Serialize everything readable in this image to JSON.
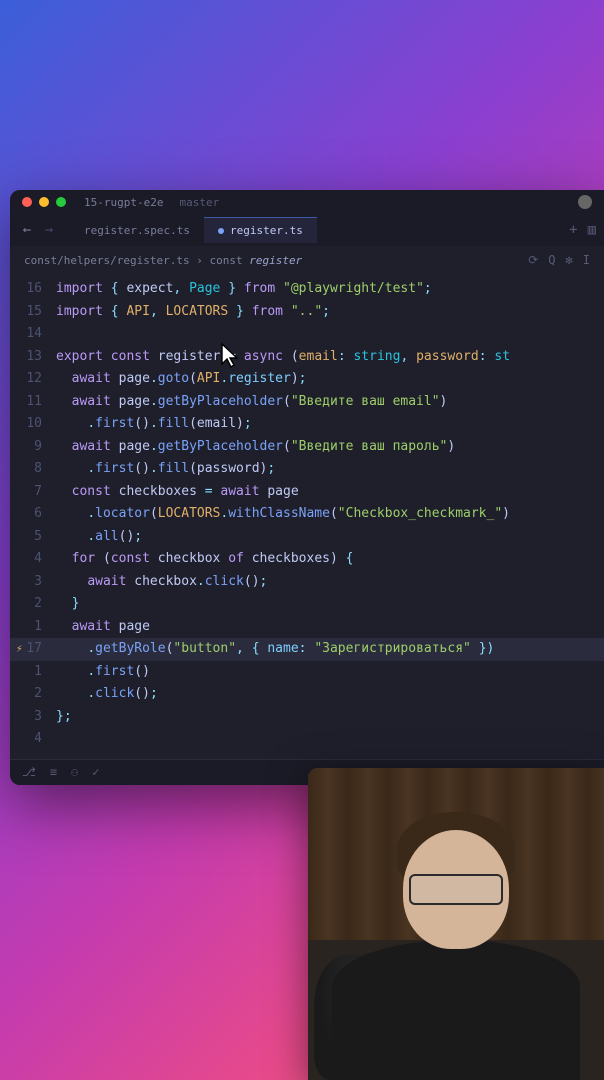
{
  "window": {
    "project": "15-rugpt-e2e",
    "branch": "master"
  },
  "tabs": [
    {
      "label": "register.spec.ts",
      "active": false
    },
    {
      "label": "register.ts",
      "active": true
    }
  ],
  "breadcrumb": {
    "path": "const/helpers/register.ts",
    "sep": " › ",
    "symbol_kw": "const",
    "symbol_name": "register"
  },
  "code": {
    "lines": [
      {
        "n": "16",
        "tokens": [
          [
            "tok-kw",
            "import"
          ],
          [
            "",
            " "
          ],
          [
            "tok-punc",
            "{"
          ],
          [
            "",
            " "
          ],
          [
            "tok-var",
            "expect"
          ],
          [
            "tok-punc",
            ","
          ],
          [
            "",
            " "
          ],
          [
            "tok-type",
            "Page"
          ],
          [
            "",
            " "
          ],
          [
            "tok-punc",
            "}"
          ],
          [
            "",
            " "
          ],
          [
            "tok-kw",
            "from"
          ],
          [
            "",
            " "
          ],
          [
            "tok-str",
            "\"@playwright/test\""
          ],
          [
            "tok-punc",
            ";"
          ]
        ]
      },
      {
        "n": "15",
        "tokens": [
          [
            "tok-kw",
            "import"
          ],
          [
            "",
            " "
          ],
          [
            "tok-punc",
            "{"
          ],
          [
            "",
            " "
          ],
          [
            "tok-const",
            "API"
          ],
          [
            "tok-punc",
            ","
          ],
          [
            "",
            " "
          ],
          [
            "tok-const",
            "LOCATORS"
          ],
          [
            "",
            " "
          ],
          [
            "tok-punc",
            "}"
          ],
          [
            "",
            " "
          ],
          [
            "tok-kw",
            "from"
          ],
          [
            "",
            " "
          ],
          [
            "tok-str",
            "\"..\""
          ],
          [
            "tok-punc",
            ";"
          ]
        ]
      },
      {
        "n": "14",
        "tokens": []
      },
      {
        "n": "13",
        "tokens": [
          [
            "tok-kw",
            "export"
          ],
          [
            "",
            " "
          ],
          [
            "tok-kw",
            "const"
          ],
          [
            "",
            " "
          ],
          [
            "tok-var",
            "register"
          ],
          [
            "",
            " "
          ],
          [
            "tok-punc",
            "="
          ],
          [
            "",
            " "
          ],
          [
            "tok-kw",
            "async"
          ],
          [
            "",
            " "
          ],
          [
            "tok-paren",
            "("
          ],
          [
            "tok-param",
            "email"
          ],
          [
            "tok-punc",
            ":"
          ],
          [
            "",
            " "
          ],
          [
            "tok-type",
            "string"
          ],
          [
            "tok-punc",
            ","
          ],
          [
            "",
            " "
          ],
          [
            "tok-param",
            "password"
          ],
          [
            "tok-punc",
            ":"
          ],
          [
            "",
            " "
          ],
          [
            "tok-type",
            "st"
          ]
        ]
      },
      {
        "n": "12",
        "tokens": [
          [
            "",
            "  "
          ],
          [
            "tok-kw",
            "await"
          ],
          [
            "",
            " "
          ],
          [
            "tok-var",
            "page"
          ],
          [
            "tok-dot",
            "."
          ],
          [
            "tok-fn",
            "goto"
          ],
          [
            "tok-paren",
            "("
          ],
          [
            "tok-const",
            "API"
          ],
          [
            "tok-dot",
            "."
          ],
          [
            "tok-prop",
            "register"
          ],
          [
            "tok-paren",
            ")"
          ],
          [
            "tok-punc",
            ";"
          ]
        ]
      },
      {
        "n": "11",
        "tokens": [
          [
            "",
            "  "
          ],
          [
            "tok-kw",
            "await"
          ],
          [
            "",
            " "
          ],
          [
            "tok-var",
            "page"
          ],
          [
            "tok-dot",
            "."
          ],
          [
            "tok-fn",
            "getByPlaceholder"
          ],
          [
            "tok-paren",
            "("
          ],
          [
            "tok-str",
            "\"Введите ваш email\""
          ],
          [
            "tok-paren",
            ")"
          ]
        ]
      },
      {
        "n": "10",
        "tokens": [
          [
            "",
            "    "
          ],
          [
            "tok-dot",
            "."
          ],
          [
            "tok-fn",
            "first"
          ],
          [
            "tok-paren",
            "()"
          ],
          [
            "tok-dot",
            "."
          ],
          [
            "tok-fn",
            "fill"
          ],
          [
            "tok-paren",
            "("
          ],
          [
            "tok-var",
            "email"
          ],
          [
            "tok-paren",
            ")"
          ],
          [
            "tok-punc",
            ";"
          ]
        ]
      },
      {
        "n": "9",
        "tokens": [
          [
            "",
            "  "
          ],
          [
            "tok-kw",
            "await"
          ],
          [
            "",
            " "
          ],
          [
            "tok-var",
            "page"
          ],
          [
            "tok-dot",
            "."
          ],
          [
            "tok-fn",
            "getByPlaceholder"
          ],
          [
            "tok-paren",
            "("
          ],
          [
            "tok-str",
            "\"Введите ваш пароль\""
          ],
          [
            "tok-paren",
            ")"
          ]
        ]
      },
      {
        "n": "8",
        "tokens": [
          [
            "",
            "    "
          ],
          [
            "tok-dot",
            "."
          ],
          [
            "tok-fn",
            "first"
          ],
          [
            "tok-paren",
            "()"
          ],
          [
            "tok-dot",
            "."
          ],
          [
            "tok-fn",
            "fill"
          ],
          [
            "tok-paren",
            "("
          ],
          [
            "tok-var",
            "password"
          ],
          [
            "tok-paren",
            ")"
          ],
          [
            "tok-punc",
            ";"
          ]
        ]
      },
      {
        "n": "7",
        "tokens": [
          [
            "",
            "  "
          ],
          [
            "tok-kw",
            "const"
          ],
          [
            "",
            " "
          ],
          [
            "tok-var",
            "checkboxes"
          ],
          [
            "",
            " "
          ],
          [
            "tok-punc",
            "="
          ],
          [
            "",
            " "
          ],
          [
            "tok-kw",
            "await"
          ],
          [
            "",
            " "
          ],
          [
            "tok-var",
            "page"
          ]
        ]
      },
      {
        "n": "6",
        "tokens": [
          [
            "",
            "    "
          ],
          [
            "tok-dot",
            "."
          ],
          [
            "tok-fn",
            "locator"
          ],
          [
            "tok-paren",
            "("
          ],
          [
            "tok-const",
            "LOCATORS"
          ],
          [
            "tok-dot",
            "."
          ],
          [
            "tok-fn",
            "withClassName"
          ],
          [
            "tok-paren",
            "("
          ],
          [
            "tok-str",
            "\"Checkbox_checkmark_\""
          ],
          [
            "tok-paren",
            ")"
          ]
        ]
      },
      {
        "n": "5",
        "tokens": [
          [
            "",
            "    "
          ],
          [
            "tok-dot",
            "."
          ],
          [
            "tok-fn",
            "all"
          ],
          [
            "tok-paren",
            "()"
          ],
          [
            "tok-punc",
            ";"
          ]
        ]
      },
      {
        "n": "4",
        "tokens": [
          [
            "",
            "  "
          ],
          [
            "tok-kw",
            "for"
          ],
          [
            "",
            " "
          ],
          [
            "tok-paren",
            "("
          ],
          [
            "tok-kw",
            "const"
          ],
          [
            "",
            " "
          ],
          [
            "tok-var",
            "checkbox"
          ],
          [
            "",
            " "
          ],
          [
            "tok-kw",
            "of"
          ],
          [
            "",
            " "
          ],
          [
            "tok-var",
            "checkboxes"
          ],
          [
            "tok-paren",
            ")"
          ],
          [
            "",
            " "
          ],
          [
            "tok-punc",
            "{"
          ]
        ]
      },
      {
        "n": "3",
        "tokens": [
          [
            "",
            "    "
          ],
          [
            "tok-kw",
            "await"
          ],
          [
            "",
            " "
          ],
          [
            "tok-var",
            "checkbox"
          ],
          [
            "tok-dot",
            "."
          ],
          [
            "tok-fn",
            "click"
          ],
          [
            "tok-paren",
            "()"
          ],
          [
            "tok-punc",
            ";"
          ]
        ]
      },
      {
        "n": "2",
        "tokens": [
          [
            "",
            "  "
          ],
          [
            "tok-punc",
            "}"
          ]
        ]
      },
      {
        "n": "1",
        "tokens": [
          [
            "",
            "  "
          ],
          [
            "tok-kw",
            "await"
          ],
          [
            "",
            " "
          ],
          [
            "tok-var",
            "page"
          ]
        ]
      },
      {
        "n": "17",
        "hl": true,
        "icon": "⚡",
        "tokens": [
          [
            "",
            "    "
          ],
          [
            "tok-dot",
            "."
          ],
          [
            "tok-fn",
            "getByRole"
          ],
          [
            "tok-paren",
            "("
          ],
          [
            "tok-str",
            "\"button\""
          ],
          [
            "tok-punc",
            ","
          ],
          [
            "",
            " "
          ],
          [
            "tok-punc",
            "{"
          ],
          [
            "",
            " "
          ],
          [
            "tok-prop",
            "name"
          ],
          [
            "tok-punc",
            ":"
          ],
          [
            "",
            " "
          ],
          [
            "tok-str",
            "\"Зарегистрироваться\""
          ],
          [
            "",
            " "
          ],
          [
            "tok-punc",
            "})"
          ]
        ]
      },
      {
        "n": "1",
        "tokens": [
          [
            "",
            "    "
          ],
          [
            "tok-dot",
            "."
          ],
          [
            "tok-fn",
            "first"
          ],
          [
            "tok-paren",
            "()"
          ]
        ]
      },
      {
        "n": "2",
        "tokens": [
          [
            "",
            "    "
          ],
          [
            "tok-dot",
            "."
          ],
          [
            "tok-fn",
            "click"
          ],
          [
            "tok-paren",
            "()"
          ],
          [
            "tok-punc",
            ";"
          ]
        ]
      },
      {
        "n": "3",
        "tokens": [
          [
            "tok-punc",
            "};"
          ]
        ]
      },
      {
        "n": "4",
        "tokens": []
      }
    ]
  },
  "nav_icons": {
    "plus": "+",
    "split": "▥"
  },
  "bc_icons": {
    "refresh": "⟳",
    "search": "Q",
    "ext": "✻",
    "cursor": "I"
  },
  "status_icons": [
    "⎇",
    "≡",
    "⚇",
    "✓"
  ]
}
